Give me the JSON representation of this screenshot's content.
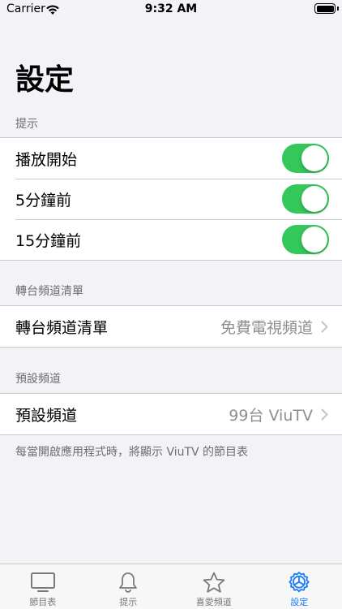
{
  "status_bar": {
    "carrier": "Carrier",
    "time": "9:32 AM"
  },
  "page_title": "設定",
  "sections": {
    "reminders": {
      "header": "提示",
      "rows": [
        {
          "label": "播放開始",
          "toggle_on": true
        },
        {
          "label": "5分鐘前",
          "toggle_on": true
        },
        {
          "label": "15分鐘前",
          "toggle_on": true
        }
      ]
    },
    "channel_list": {
      "header": "轉台頻道清單",
      "row": {
        "label": "轉台頻道清單",
        "value": "免費電視頻道"
      }
    },
    "default_channel": {
      "header": "預設頻道",
      "row": {
        "label": "預設頻道",
        "value": "99台 ViuTV"
      },
      "footer": "每當開啟應用程式時，將顯示 ViuTV 的節目表"
    }
  },
  "tab_bar": {
    "tabs": [
      {
        "label": "節目表",
        "icon": "tv-icon",
        "active": false
      },
      {
        "label": "提示",
        "icon": "bell-icon",
        "active": false
      },
      {
        "label": "喜愛頻道",
        "icon": "star-icon",
        "active": false
      },
      {
        "label": "設定",
        "icon": "gear-icon",
        "active": true
      }
    ]
  },
  "colors": {
    "background": "#f2f2f7",
    "toggle_on": "#34c759",
    "active_tab": "#1a7cf5",
    "inactive_tab": "#7a7a7a",
    "secondary_text": "#8e8e93"
  }
}
